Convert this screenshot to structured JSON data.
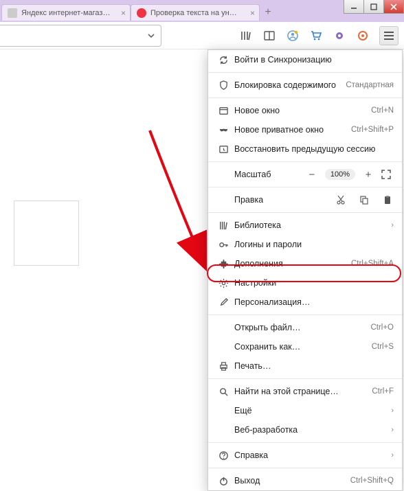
{
  "window": {
    "tabs": [
      {
        "title": "Яндекс интернет-магазин п…"
      },
      {
        "title": "Проверка текста на уника…"
      }
    ]
  },
  "menu": {
    "sync": "Войти в Синхронизацию",
    "block": "Блокировка содержимого",
    "block_right": "Стандартная",
    "new_window": "Новое окно",
    "new_window_sc": "Ctrl+N",
    "private": "Новое приватное окно",
    "private_sc": "Ctrl+Shift+P",
    "restore": "Восстановить предыдущую сессию",
    "zoom_label": "Масштаб",
    "zoom_value": "100%",
    "edit_label": "Правка",
    "library": "Библиотека",
    "logins": "Логины и пароли",
    "addons": "Дополнения",
    "addons_sc": "Ctrl+Shift+A",
    "settings": "Настройки",
    "customize": "Персонализация…",
    "open": "Открыть файл…",
    "open_sc": "Ctrl+O",
    "save": "Сохранить как…",
    "save_sc": "Ctrl+S",
    "print": "Печать…",
    "find": "Найти на этой странице…",
    "find_sc": "Ctrl+F",
    "more": "Ещё",
    "webdev": "Веб-разработка",
    "help": "Справка",
    "exit": "Выход",
    "exit_sc": "Ctrl+Shift+Q"
  }
}
